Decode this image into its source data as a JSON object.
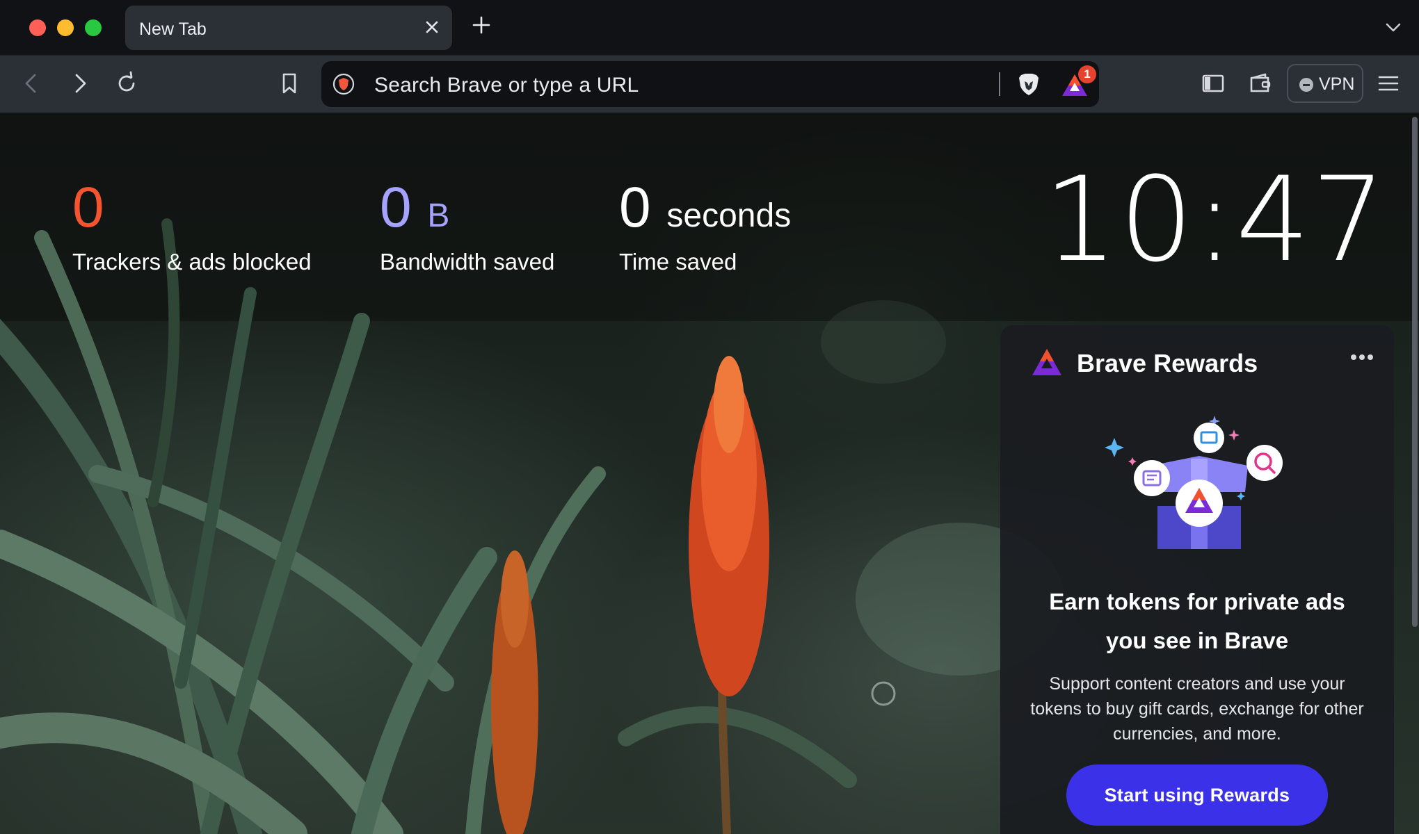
{
  "window": {
    "tab": {
      "title": "New Tab"
    }
  },
  "toolbar": {
    "url_placeholder": "Search Brave or type a URL",
    "rewards_badge": "1",
    "vpn_label": "VPN"
  },
  "stats": {
    "trackers": {
      "value": "0",
      "label": "Trackers & ads blocked",
      "color": "#f4542e"
    },
    "bandwidth": {
      "value": "0",
      "unit": "B",
      "label": "Bandwidth saved",
      "color": "#a5a3ff"
    },
    "time": {
      "value": "0",
      "unit": "seconds",
      "label": "Time saved",
      "color": "#ffffff"
    }
  },
  "clock": {
    "time": "10:47"
  },
  "rewards_card": {
    "title": "Brave Rewards",
    "headline_line1": "Earn tokens for private ads",
    "headline_line2": "you see in Brave",
    "body": "Support content creators and use your tokens to buy gift cards, exchange for other currencies, and more.",
    "button_label": "Start using Rewards",
    "button_color": "#3a31e8"
  }
}
